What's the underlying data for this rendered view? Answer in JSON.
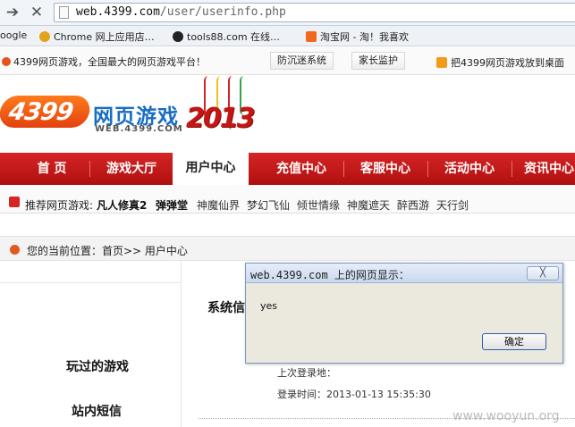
{
  "browser": {
    "back_icon": "arrow-right-icon",
    "stop_icon": "close-icon",
    "url_domain": "web.4399.com",
    "url_path": "/user/userinfo.php",
    "bookmarks": [
      {
        "label": "oogle",
        "icon": "google-icon",
        "color": "#4a86e8"
      },
      {
        "label": "Chrome 网上应用店…",
        "icon": "chrome-webstore-icon",
        "color": "#e3a21a"
      },
      {
        "label": "tools88.com 在线…",
        "icon": "radiation-icon",
        "color": "#222222"
      },
      {
        "label": "淘宝网 - 淘！我喜欢",
        "icon": "taobao-icon",
        "color": "#f26b1d"
      }
    ]
  },
  "site": {
    "slogan": "4399网页游戏，全国最大的网页游戏平台！",
    "top_links": [
      "防沉迷系统",
      "家长监护"
    ],
    "add_fav": "把4399网页游戏放到桌面",
    "logo_num": "4399",
    "logo_name": "网页游戏",
    "logo_url": "WEB.4399.COM",
    "logo_year": "2013",
    "nav": [
      "首 页",
      "游戏大厅",
      "用户中心",
      "充值中心",
      "客服中心",
      "活动中心",
      "资讯中心"
    ],
    "nav_active_index": 2,
    "recommend_label": "推荐网页游戏:",
    "recommend_games": [
      {
        "name": "凡人修真2",
        "bold": true
      },
      {
        "name": "弹弹堂",
        "bold": true
      },
      {
        "name": "神魔仙界",
        "bold": false
      },
      {
        "name": "梦幻飞仙",
        "bold": false
      },
      {
        "name": "倾世情缘",
        "bold": false
      },
      {
        "name": "神魔遮天",
        "bold": false
      },
      {
        "name": "醉西游",
        "bold": false
      },
      {
        "name": "天行剑",
        "bold": false
      }
    ],
    "breadcrumb": "您的当前位置：首页>> 用户中心",
    "left_menu": [
      "玩过的游戏",
      "站内短信"
    ],
    "section_title": "系统信",
    "last_login_place": "上次登录地：",
    "login_time": "登录时间：2013-01-13 15:35:30"
  },
  "dialog": {
    "title": "web.4399.com 上的网页显示：",
    "close_label": "╳",
    "message": "yes",
    "ok_label": "确定"
  },
  "watermark": "www.wooyun.org",
  "colors": {
    "nav_red": "#c41a1a",
    "logo_orange": "#e8501f",
    "logo_blue": "#1a6dc4"
  }
}
